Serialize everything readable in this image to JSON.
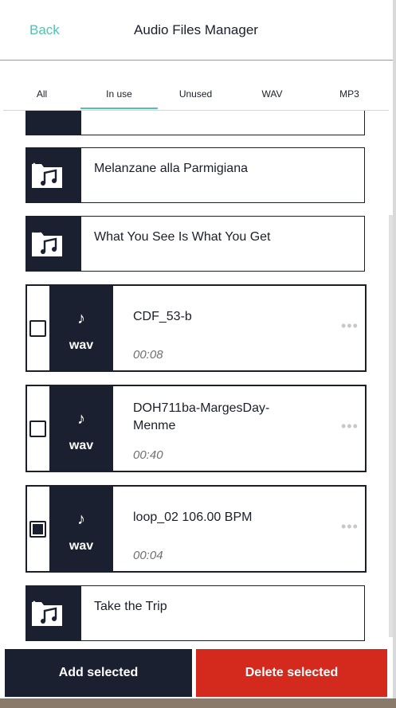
{
  "header": {
    "back_label": "Back",
    "title": "Audio Files Manager"
  },
  "tabs": [
    {
      "label": "All"
    },
    {
      "label": "In use"
    },
    {
      "label": "Unused"
    },
    {
      "label": "WAV"
    },
    {
      "label": "MP3"
    }
  ],
  "active_tab": "In use",
  "folders": [
    {
      "name": "Melanzane alla Parmigiana",
      "icon": "music-folder-icon",
      "expand": "chevron-right"
    },
    {
      "name": "What You See Is What You Get",
      "icon": "music-folder-icon",
      "expand": "chevron-down"
    },
    {
      "name": "Take the Trip",
      "icon": "music-folder-icon",
      "expand": "chevron-right"
    }
  ],
  "files": [
    {
      "name": "CDF_53-b",
      "type": "wav",
      "duration": "00:08",
      "checked": false
    },
    {
      "name": "DOH711ba-MargesDay-Menme",
      "type": "wav",
      "duration": "00:40",
      "checked": false
    },
    {
      "name": "loop_02 106.00 BPM",
      "type": "wav",
      "duration": "00:04",
      "checked": true
    }
  ],
  "actions": {
    "add_label": "Add selected",
    "delete_label": "Delete selected"
  },
  "colors": {
    "accent": "#4fc3b4",
    "dark": "#1b2030",
    "danger": "#d42a1e"
  }
}
